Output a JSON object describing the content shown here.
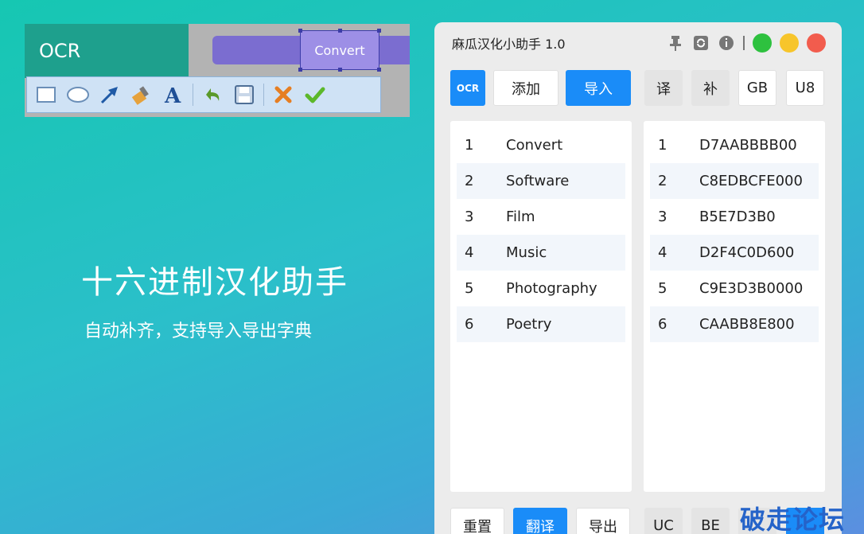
{
  "banner": {
    "ocr_label": "OCR",
    "convert_label": "Convert",
    "hero_title": "十六进制汉化助手",
    "hero_subtitle": "自动补齐，支持导入导出字典"
  },
  "window": {
    "title": "麻瓜汉化小助手 1.0",
    "buttons_top": {
      "ocr": "OCR",
      "add": "添加",
      "import": "导入",
      "translate": "译",
      "fill": "补",
      "gb": "GB",
      "u8": "U8"
    },
    "left_list": [
      {
        "num": "1",
        "text": "Convert"
      },
      {
        "num": "2",
        "text": "Software"
      },
      {
        "num": "3",
        "text": "Film"
      },
      {
        "num": "4",
        "text": "Music"
      },
      {
        "num": "5",
        "text": "Photography"
      },
      {
        "num": "6",
        "text": "Poetry"
      }
    ],
    "right_list": [
      {
        "num": "1",
        "text": "D7AABBBB00"
      },
      {
        "num": "2",
        "text": "C8EDBCFE000"
      },
      {
        "num": "3",
        "text": "B5E7D3B0"
      },
      {
        "num": "4",
        "text": "D2F4C0D600"
      },
      {
        "num": "5",
        "text": "C9E3D3B0000"
      },
      {
        "num": "6",
        "text": "CAABB8E800"
      }
    ],
    "buttons_bottom": {
      "reset": "重置",
      "translate": "翻译",
      "export": "导出",
      "uc": "UC",
      "be": "BE"
    }
  },
  "watermark": "破走论坛",
  "colors": {
    "accent": "#1a8cf8",
    "green": "#2ec13f",
    "yellow": "#f7c52b",
    "red": "#f25c4d"
  }
}
